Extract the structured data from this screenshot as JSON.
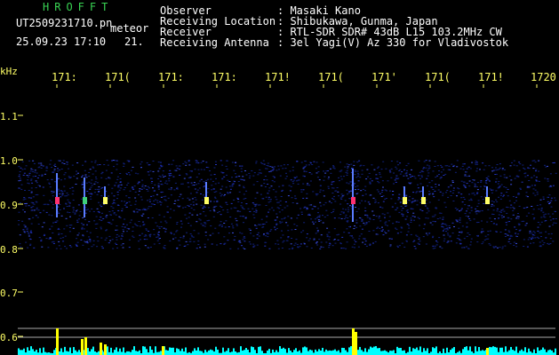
{
  "header": {
    "brand": "HROFFT",
    "filename": "UT2509231710.pn",
    "tag": "meteor",
    "date": "25.09.23 17:10",
    "extra": "21.",
    "labels": [
      "Observer",
      "Receiving Location",
      "Receiver",
      "Receiving Antenna"
    ],
    "values": [
      ": Masaki Kano",
      ": Shibukawa, Gunma, Japan",
      ": RTL-SDR SDR# 43dB L15 103.2MHz CW",
      ": 3el Yagi(V) Az 330 for Vladivostok"
    ]
  },
  "time_axis": {
    "ticks": [
      "171:",
      "171(",
      "171:",
      "171:",
      "171!",
      "171(",
      "171'",
      "171(",
      "171!",
      "1720"
    ]
  },
  "freq_axis": {
    "unit": "kHz",
    "ticks": [
      "1.1",
      "1.0",
      "0.9",
      "0.8",
      "0.7",
      "0.6"
    ]
  },
  "colors": {
    "bg": "#000000",
    "noise": "#1a2aa8",
    "trace": "#ffff00",
    "baseline": "#00ffff",
    "header_green": "#39d353"
  }
}
